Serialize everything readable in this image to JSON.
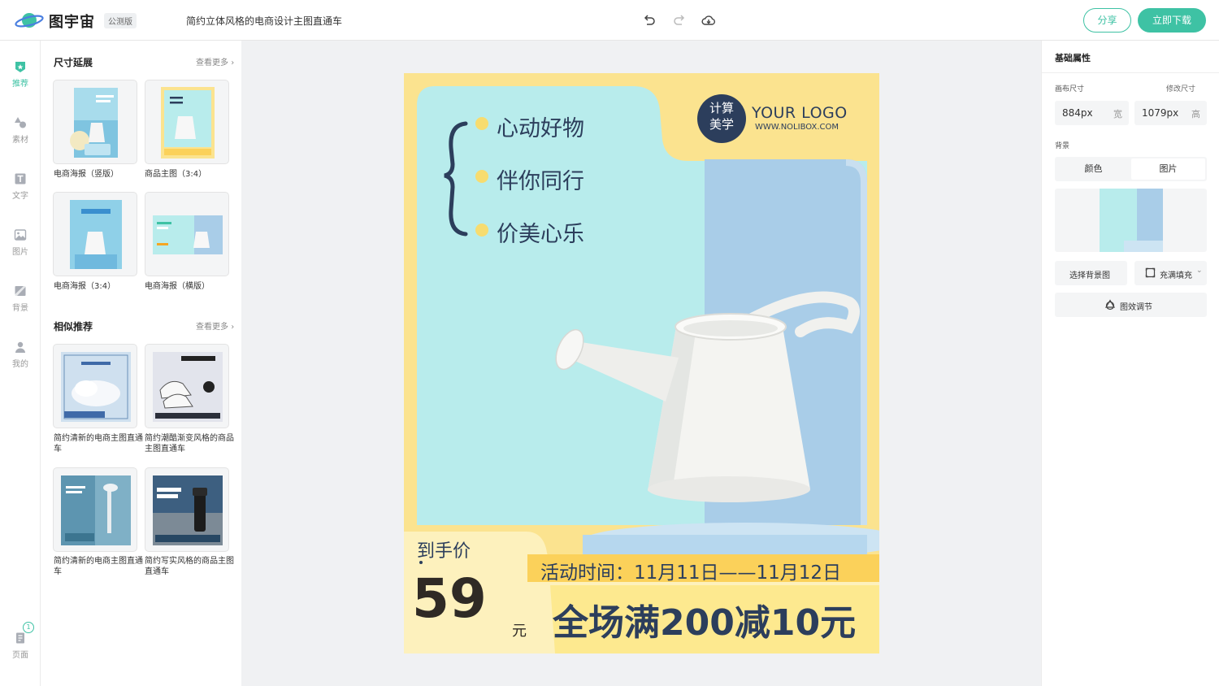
{
  "header": {
    "brand": "图宇宙",
    "edition": "公测版",
    "doc_title": "简约立体风格的电商设计主图直通车",
    "share_label": "分享",
    "download_label": "立即下载"
  },
  "rail": {
    "items": [
      {
        "label": "推荐"
      },
      {
        "label": "素材"
      },
      {
        "label": "文字"
      },
      {
        "label": "图片"
      },
      {
        "label": "背景"
      },
      {
        "label": "我的"
      }
    ],
    "page_label": "页面",
    "page_count": "1"
  },
  "panel": {
    "size_section": {
      "title": "尺寸延展",
      "more": "查看更多",
      "items": [
        {
          "caption": "电商海报（竖版）"
        },
        {
          "caption": "商品主图（3:4）"
        },
        {
          "caption": "电商海报（3:4）"
        },
        {
          "caption": "电商海报（横版）"
        }
      ]
    },
    "similar_section": {
      "title": "相似推荐",
      "more": "查看更多",
      "items": [
        {
          "caption": "简约清新的电商主图直通车"
        },
        {
          "caption": "简约潮酷渐变风格的商品主图直通车"
        },
        {
          "caption": "简约清新的电商主图直通车"
        },
        {
          "caption": "简约写实风格的商品主图直通车"
        }
      ]
    }
  },
  "poster": {
    "slogans": [
      "心动好物",
      "伴你同行",
      "价美心乐"
    ],
    "logo_seal": [
      "计",
      "算",
      "美",
      "学"
    ],
    "logo_text": "YOUR LOGO",
    "logo_url": "WWW.NOLIBOX.COM",
    "price_label": "到手价",
    "price": "59",
    "price_unit": "元",
    "event_time": "活动时间：11月11日——11月12日",
    "promo": "全场满200减10元"
  },
  "props": {
    "title": "基础属性",
    "canvas_size_label": "画布尺寸",
    "resize_link": "修改尺寸",
    "width_value": "884px",
    "width_unit": "宽",
    "height_value": "1079px",
    "height_unit": "高",
    "bg_label": "背景",
    "bg_tabs": [
      "颜色",
      "图片"
    ],
    "select_bg": "选择背景图",
    "fill_mode": "充满填充",
    "effects": "图效调节"
  },
  "colors": {
    "accent": "#3ec2a4",
    "poster_yellow": "#fbe38f",
    "poster_cyan": "#b8ecec",
    "poster_blue": "#a9cde8",
    "navy_text": "#2c3e5c"
  }
}
